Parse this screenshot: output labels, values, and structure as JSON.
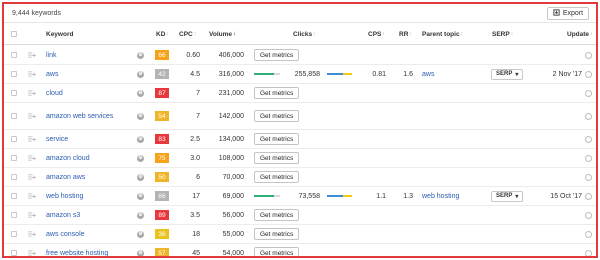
{
  "header": {
    "keyword_count": "9,444 keywords",
    "export_label": "Export"
  },
  "columns": {
    "keyword": "Keyword",
    "kd": "KD",
    "cpc": "CPC",
    "volume": "Volume",
    "clicks": "Clicks",
    "cps": "CPS",
    "rr": "RR",
    "parent_topic": "Parent topic",
    "serp": "SERP",
    "update": "Update"
  },
  "get_metrics_label": "Get metrics",
  "serp_button_label": "SERP",
  "kd_colors": {
    "orange": "#f7a21b",
    "gray": "#b4b4b4",
    "red": "#e8383d",
    "amber": "#f0b429",
    "green": "#9cc23a",
    "yellow": "#e8c21f"
  },
  "rows": [
    {
      "keyword": "link",
      "kd": "66",
      "kd_color": "orange",
      "cpc": "0.60",
      "volume": "406,000",
      "mode": "metrics"
    },
    {
      "keyword": "aws",
      "kd": "42",
      "kd_color": "gray",
      "cpc": "4.5",
      "volume": "316,000",
      "mode": "full",
      "clicks": "255,858",
      "cps": "0.81",
      "rr": "1.6",
      "parent_topic": "aws",
      "update": "2 Nov '17"
    },
    {
      "keyword": "cloud",
      "kd": "87",
      "kd_color": "red",
      "cpc": "7",
      "volume": "231,000",
      "mode": "metrics"
    },
    {
      "keyword": "amazon web services",
      "kd": "54",
      "kd_color": "amber",
      "cpc": "7",
      "volume": "142,000",
      "mode": "metrics"
    },
    {
      "keyword": "service",
      "kd": "83",
      "kd_color": "red",
      "cpc": "2.5",
      "volume": "134,000",
      "mode": "metrics"
    },
    {
      "keyword": "amazon cloud",
      "kd": "75",
      "kd_color": "orange",
      "cpc": "3.0",
      "volume": "108,000",
      "mode": "metrics"
    },
    {
      "keyword": "amazon aws",
      "kd": "50",
      "kd_color": "amber",
      "cpc": "6",
      "volume": "70,000",
      "mode": "metrics"
    },
    {
      "keyword": "web hosting",
      "kd": "86",
      "kd_color": "gray",
      "cpc": "17",
      "volume": "69,000",
      "mode": "full",
      "clicks": "73,558",
      "cps": "1.1",
      "rr": "1.3",
      "parent_topic": "web hosting",
      "update": "15 Oct '17"
    },
    {
      "keyword": "amazon s3",
      "kd": "89",
      "kd_color": "red",
      "cpc": "3.5",
      "volume": "56,000",
      "mode": "metrics"
    },
    {
      "keyword": "aws console",
      "kd": "36",
      "kd_color": "yellow",
      "cpc": "18",
      "volume": "55,000",
      "mode": "metrics"
    },
    {
      "keyword": "free website hosting",
      "kd": "57",
      "kd_color": "amber",
      "cpc": "45",
      "volume": "54,000",
      "mode": "metrics"
    }
  ]
}
